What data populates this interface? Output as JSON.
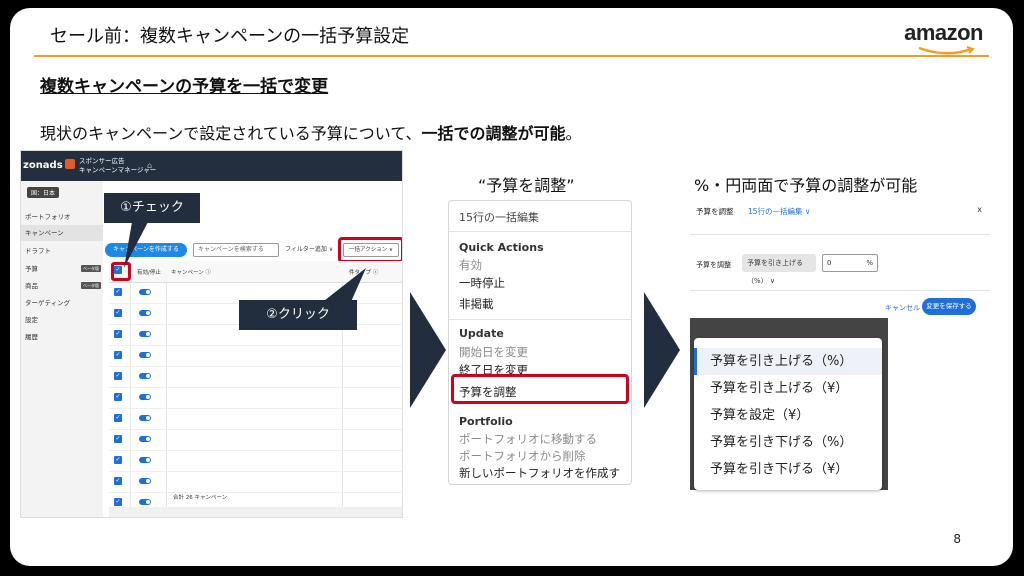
{
  "slide": {
    "title": "セール前：複数キャンペーンの一括予算設定",
    "logo": "amazon",
    "heading": "複数キャンペーンの予算を一括で変更",
    "desc_pre": "現状のキャンペーンで設定されている予算について、",
    "desc_bold": "一括での調整が可能",
    "desc_post": "。",
    "page_number": "8"
  },
  "colors": {
    "accent": "#f79a1e",
    "navy": "#222e3d",
    "highlight": "#d0021b",
    "link": "#1e6fd9"
  },
  "console": {
    "brand": "zonads",
    "manager_line1": "スポンサー広告",
    "manager_line2": "キャンペーンマネージャー",
    "home_icon": "home-icon",
    "country": "国：日本",
    "nav": [
      {
        "label": "ポートフォリオ",
        "tag": ""
      },
      {
        "label": "キャンペーン",
        "tag": ""
      },
      {
        "label": "ドラフト",
        "tag": ""
      },
      {
        "label": "予算",
        "tag": "ベータ版"
      },
      {
        "label": "商品",
        "tag": "ベータ版"
      },
      {
        "label": "ターゲティング",
        "tag": ""
      },
      {
        "label": "設定",
        "tag": ""
      },
      {
        "label": "履歴",
        "tag": ""
      }
    ],
    "create_label": "キャンペーンを作成する",
    "search_placeholder": "キャンペーンを検索する",
    "filter_label": "フィルター追加 ∨",
    "bulk_label": "一括アクション ∨",
    "col_active": "有効/停止",
    "col_campaign": "キャンペーン ⓘ",
    "col_type": "件タイプ ⓘ",
    "total": "合計 26 キャンペーン"
  },
  "callouts": {
    "check": "①チェック",
    "click": "②クリック"
  },
  "menu": {
    "label": "“予算を調整”",
    "header": "15行の一括編集",
    "sections": [
      {
        "title": "Quick Actions",
        "items": [
          "有効",
          "一時停止",
          "非掲載"
        ]
      },
      {
        "title": "Update",
        "items": [
          "開始日を変更",
          "終了日を変更",
          "予算を調整"
        ]
      },
      {
        "title": "Portfolio",
        "items": [
          "ポートフォリオに移動する",
          "ポートフォリオから削除",
          "新しいポートフォリオを作成する"
        ]
      }
    ]
  },
  "adjust": {
    "label": "%・円両面で予算の調整が可能",
    "title": "予算を調整",
    "subtitle": "15行の一括編集 ∨",
    "close": "x",
    "row_label": "予算を調整",
    "select_value": "予算を引き上げる（%） ∨",
    "input_value": "0",
    "input_unit": "%",
    "cancel": "キャンセル",
    "save": "変更を保存する",
    "options": [
      "予算を引き上げる（%）",
      "予算を引き上げる（¥）",
      "予算を設定（¥）",
      "予算を引き下げる（%）",
      "予算を引き下げる（¥）"
    ]
  }
}
